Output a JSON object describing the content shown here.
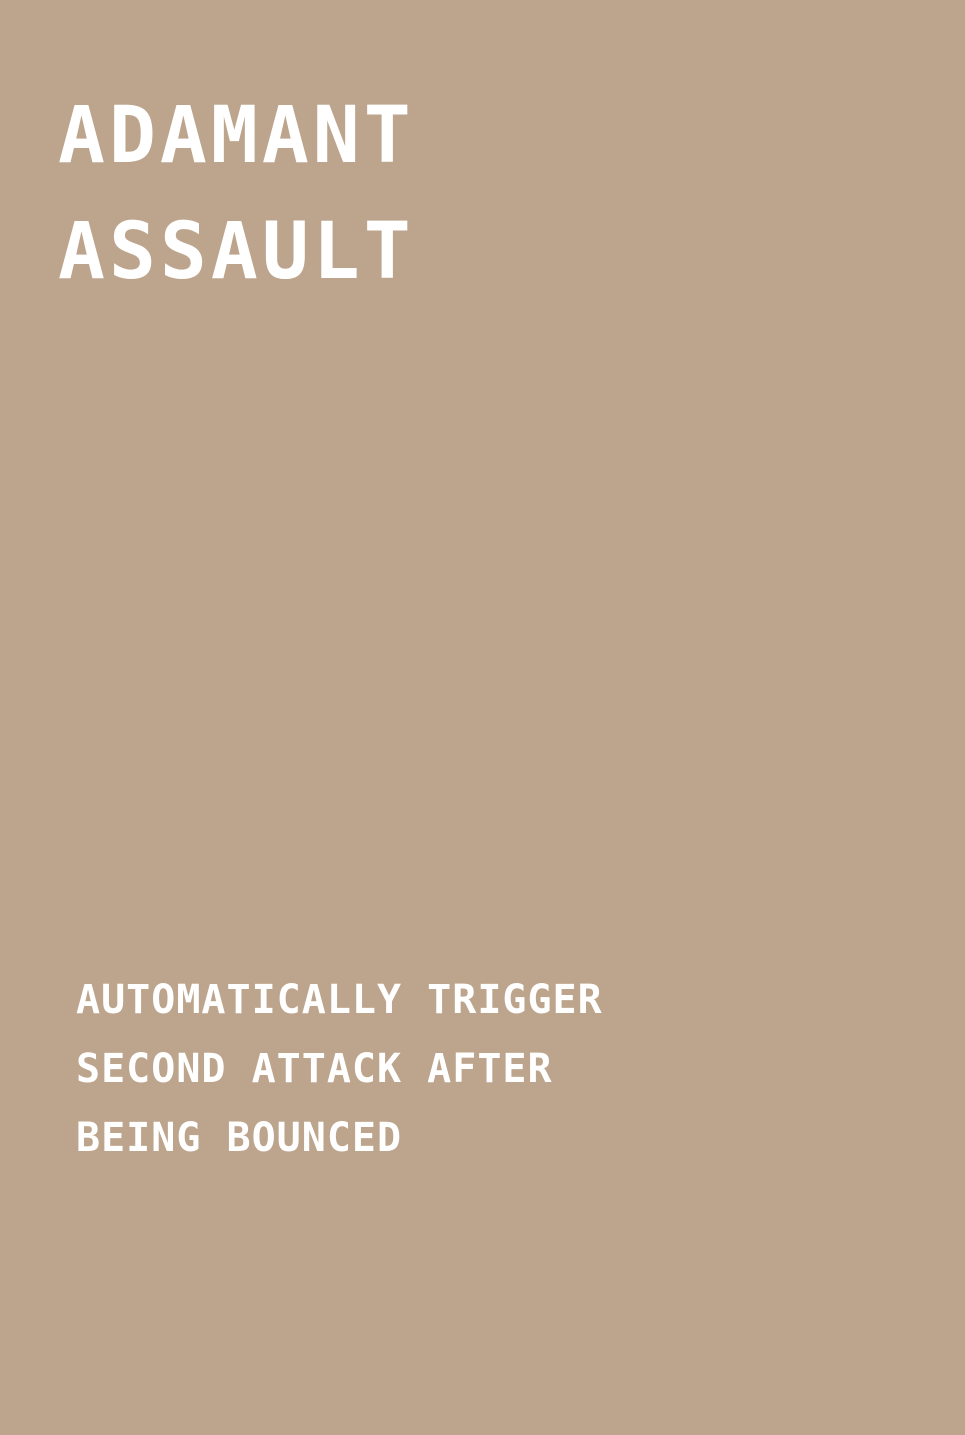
{
  "card": {
    "title_lines": [
      "ADAMANT",
      "ASSAULT"
    ],
    "description_lines": [
      "AUTOMATICALLY TRIGGER",
      "SECOND ATTACK AFTER",
      "BEING BOUNCED"
    ]
  },
  "colors": {
    "background": "#bda48c",
    "text": "#ffffff"
  }
}
